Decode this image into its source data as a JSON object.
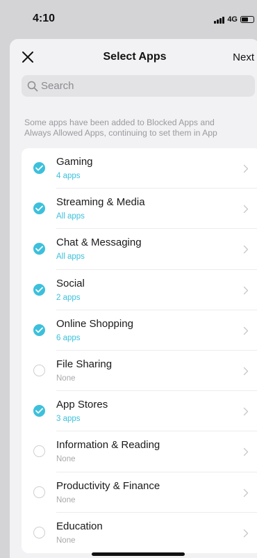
{
  "status_bar": {
    "time": "4:10",
    "network": "4G"
  },
  "header": {
    "title": "Select Apps",
    "next_label": "Next"
  },
  "search": {
    "placeholder": "Search"
  },
  "notice": {
    "line1": "Some apps have been added to Blocked Apps and",
    "line2": "Always Allowed Apps, continuing to set them in App"
  },
  "categories": [
    {
      "name": "Gaming",
      "detail": "4 apps",
      "selected": true
    },
    {
      "name": "Streaming & Media",
      "detail": "All apps",
      "selected": true
    },
    {
      "name": "Chat & Messaging",
      "detail": "All apps",
      "selected": true
    },
    {
      "name": "Social",
      "detail": "2 apps",
      "selected": true
    },
    {
      "name": "Online Shopping",
      "detail": "6 apps",
      "selected": true
    },
    {
      "name": "File Sharing",
      "detail": "None",
      "selected": false
    },
    {
      "name": "App Stores",
      "detail": "3 apps",
      "selected": true
    },
    {
      "name": "Information & Reading",
      "detail": "None",
      "selected": false
    },
    {
      "name": "Productivity & Finance",
      "detail": "None",
      "selected": false
    },
    {
      "name": "Education",
      "detail": "None",
      "selected": false
    }
  ],
  "colors": {
    "accent": "#3cc0dc",
    "sheet_bg": "#f2f2f4"
  }
}
